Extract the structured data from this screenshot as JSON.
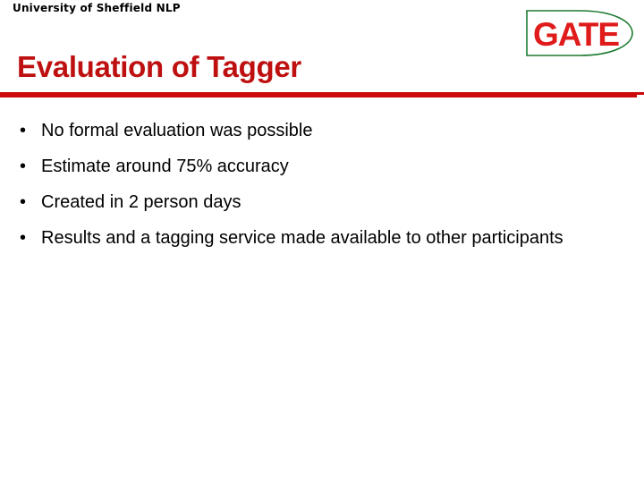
{
  "slide": {
    "dept_header": "University of Sheffield NLP",
    "title": "Evaluation of Tagger",
    "bullet_marker": "•",
    "accent_color": "#BE1010",
    "rule_color": "#CC0A0A",
    "text_color": "#000000",
    "background_color": "#FFFFFF"
  },
  "logo": {
    "text": "GATE",
    "outline_color": "#1A7A2E",
    "text_color": "#E01B1B",
    "shape": "d-shape-outline"
  },
  "bullets": [
    {
      "text": "No formal evaluation was possible"
    },
    {
      "text": "Estimate around 75% accuracy"
    },
    {
      "text": "Created in 2 person days"
    },
    {
      "text": "Results and a tagging service made available to other participants"
    }
  ]
}
